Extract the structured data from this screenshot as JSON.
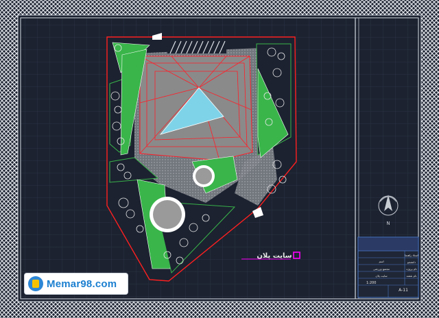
{
  "drawing": {
    "plan_label": "سایت پلان",
    "scale": "1:200",
    "sheet_no": "A-11",
    "north_label": "N"
  },
  "title_block": {
    "rows": [
      {
        "label": "استاد راهنما",
        "value": "اسم"
      },
      {
        "label": "دانشجو",
        "value": ""
      },
      {
        "label": "نام پروژه",
        "value": "مجتمع ورزشی"
      },
      {
        "label": "نام نقشه",
        "value": "سایت پلان"
      }
    ]
  },
  "watermark": {
    "brand": "Memar98",
    "domain": ".com"
  },
  "colors": {
    "background": "#1c2230",
    "frame": "#d8dde4",
    "site_boundary": "#ff2020",
    "green_space": "#39b54a",
    "paving": "#8a8a8a",
    "roof_line": "#ff1e28",
    "skylight": "#7fd3e8",
    "accent": "#ff00ff"
  }
}
